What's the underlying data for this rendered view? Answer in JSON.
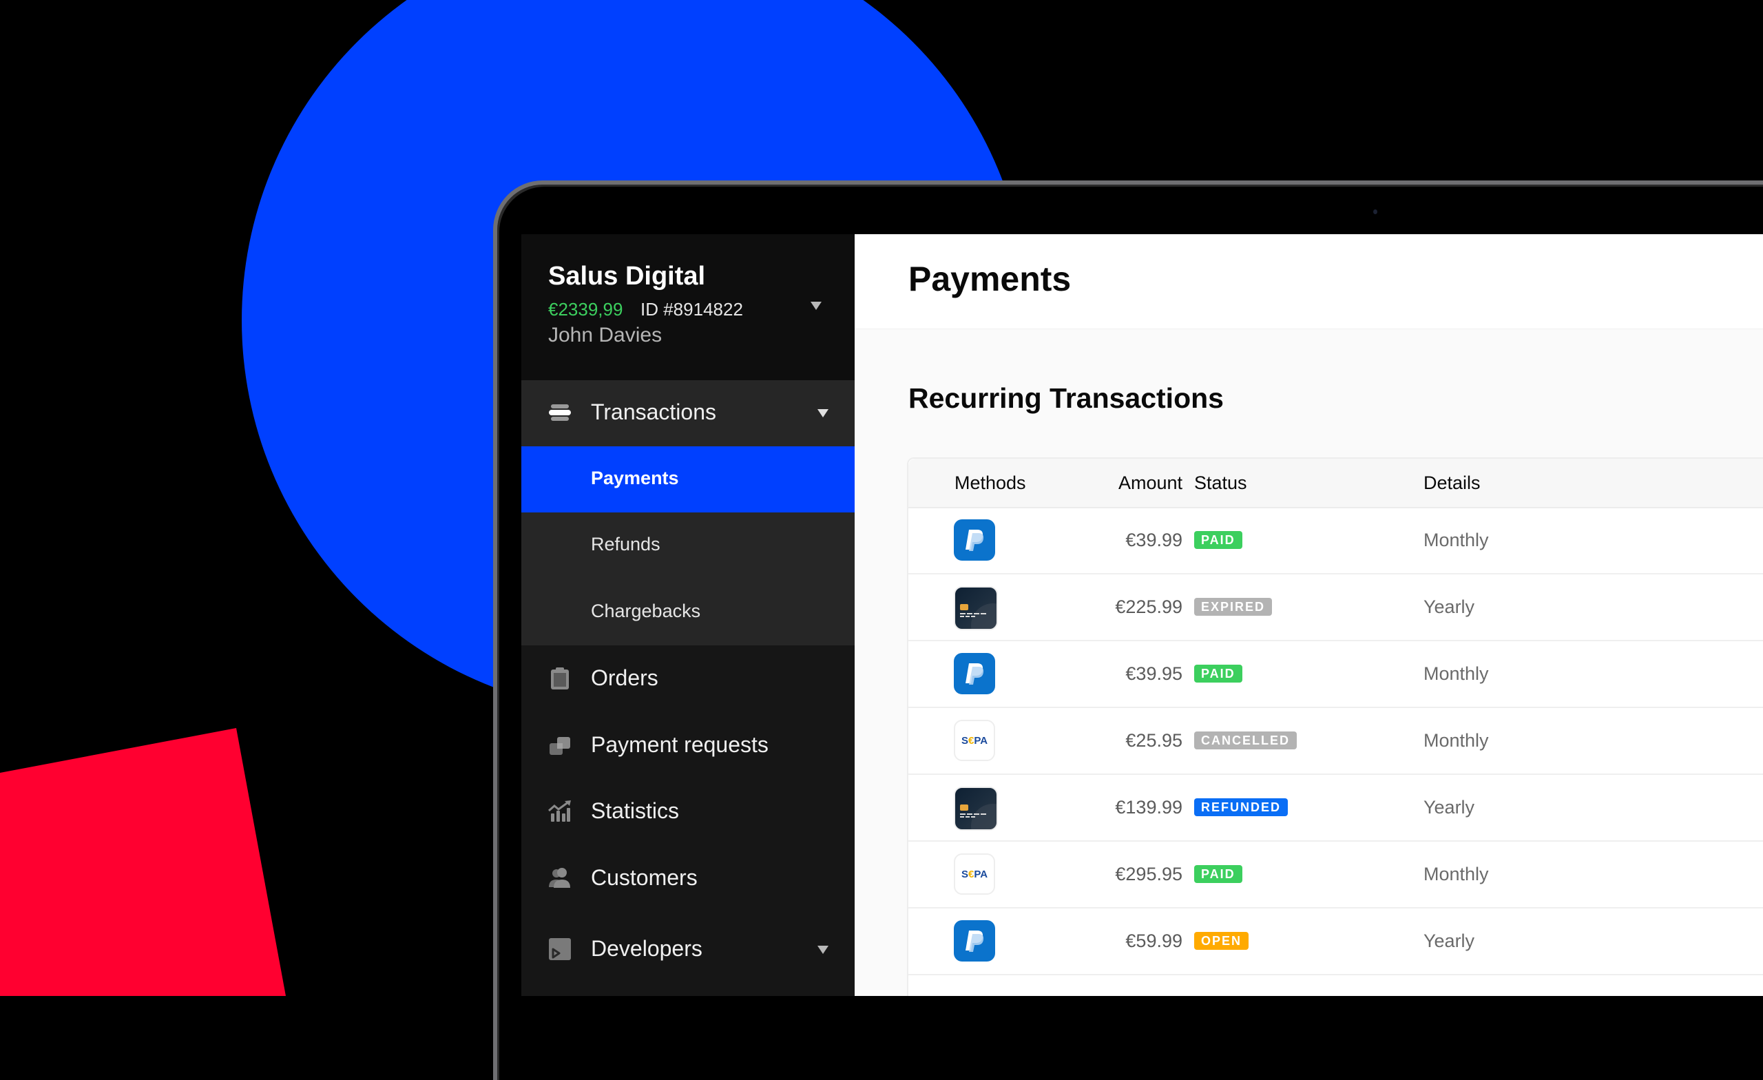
{
  "colors": {
    "accent_blue": "#0040ff",
    "background_red": "#ff0030",
    "balance_green": "#3ccf5e",
    "paid": "#3ccf5e",
    "expired": "#b3b3b3",
    "cancelled": "#b3b3b3",
    "refunded": "#0a6ef5",
    "open": "#ffaa00"
  },
  "account": {
    "name": "Salus Digital",
    "balance": "€2339,99",
    "id": "ID #8914822",
    "user": "John Davies"
  },
  "sidebar": {
    "group": {
      "label": "Transactions",
      "icon": "stack-icon",
      "expanded": true,
      "children": [
        {
          "label": "Payments",
          "active": true
        },
        {
          "label": "Refunds",
          "active": false
        },
        {
          "label": "Chargebacks",
          "active": false
        }
      ]
    },
    "items": [
      {
        "label": "Orders",
        "icon": "clipboard-icon"
      },
      {
        "label": "Payment requests",
        "icon": "payment-requests-icon"
      },
      {
        "label": "Statistics",
        "icon": "chart-icon"
      },
      {
        "label": "Customers",
        "icon": "users-icon"
      },
      {
        "label": "Developers",
        "icon": "terminal-icon",
        "has_dropdown": true
      }
    ]
  },
  "main": {
    "page_title": "Payments",
    "section_title": "Recurring Transactions",
    "table": {
      "columns": [
        "Methods",
        "Amount",
        "Status",
        "Details"
      ],
      "rows": [
        {
          "method": "paypal",
          "amount": "€39.99",
          "status": "PAID",
          "status_key": "paid",
          "details": "Monthly"
        },
        {
          "method": "card",
          "amount": "€225.99",
          "status": "EXPIRED",
          "status_key": "expired",
          "details": "Yearly"
        },
        {
          "method": "paypal",
          "amount": "€39.95",
          "status": "PAID",
          "status_key": "paid",
          "details": "Monthly"
        },
        {
          "method": "sepa",
          "amount": "€25.95",
          "status": "CANCELLED",
          "status_key": "cancelled",
          "details": "Monthly"
        },
        {
          "method": "card",
          "amount": "€139.99",
          "status": "REFUNDED",
          "status_key": "refunded",
          "details": "Yearly"
        },
        {
          "method": "sepa",
          "amount": "€295.95",
          "status": "PAID",
          "status_key": "paid",
          "details": "Monthly"
        },
        {
          "method": "paypal",
          "amount": "€59.99",
          "status": "OPEN",
          "status_key": "open",
          "details": "Yearly"
        }
      ]
    }
  }
}
